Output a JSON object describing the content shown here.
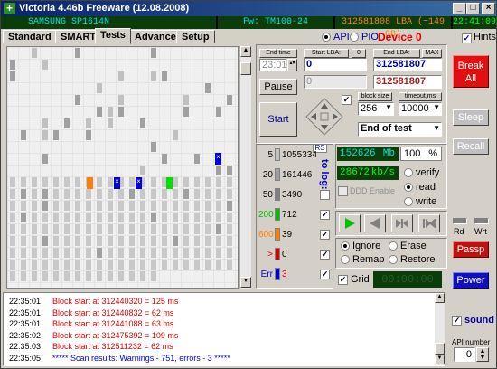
{
  "title": "Victoria 4.46b Freeware (12.08.2008)",
  "infobar": {
    "model": "SAMSUNG SP1614N",
    "fw": "Fw: TM100-24",
    "lba": "312581808 LBA (~149 GB)",
    "time": "22:41:09"
  },
  "tabs": [
    "Standard",
    "SMART",
    "Tests",
    "Advanced",
    "Setup"
  ],
  "mode": {
    "api": "API",
    "pio": "PIO",
    "device": "Device 0",
    "hints": "Hints"
  },
  "test": {
    "end_time_label": "End time",
    "end_time": "23:01",
    "start_lba_label": "Start LBA:",
    "start_lba_zero": "0",
    "start_lba": "0",
    "end_lba_label": "End LBA:",
    "end_lba_max": "MAX",
    "end_lba": "312581807",
    "end_lba2": "312581807",
    "field2": "0",
    "pause": "Pause",
    "start": "Start",
    "block_size_label": "block size",
    "block_size": "256",
    "timeout_label": "timeout,ms",
    "timeout": "10000",
    "end_of_test": "End of test"
  },
  "stats": {
    "rs": "RS",
    "to_log": "to log:",
    "rows": [
      {
        "ms": "5",
        "count": "1055334",
        "color": "#c0c0c0"
      },
      {
        "ms": "20",
        "count": "161446",
        "color": "#a0a0a0"
      },
      {
        "ms": "50",
        "count": "3490",
        "color": "#808080"
      },
      {
        "ms": "200",
        "count": "712",
        "color": "#00c000"
      },
      {
        "ms": "600",
        "count": "39",
        "color": "#ff8000"
      },
      {
        "ms": ">",
        "count": "0",
        "color": "#e00000"
      },
      {
        "ms": "Err",
        "count": "3",
        "color": "#0000e0"
      }
    ]
  },
  "progress": {
    "mb": "152626",
    "mb_unit": "Mb",
    "pct": "100",
    "pct_unit": "%",
    "speed": "28672",
    "speed_unit": "kb/s",
    "verify": "verify",
    "read": "read",
    "write": "write",
    "ddd": "DDD Enable"
  },
  "actions": {
    "ignore": "Ignore",
    "erase": "Erase",
    "remap": "Remap",
    "restore": "Restore",
    "grid": "Grid",
    "grid_time": "00:00:00"
  },
  "right": {
    "break": "Break All",
    "sleep": "Sleep",
    "recall": "Recall",
    "rd": "Rd",
    "wrt": "Wrt",
    "passp": "Passp",
    "power": "Power",
    "sound": "sound",
    "api_number_label": "API number",
    "api_number": "0"
  },
  "log": [
    {
      "time": "22:35:01",
      "text": "Block start at 312440320 = 125 ms",
      "color": "#e00000"
    },
    {
      "time": "22:35:01",
      "text": "Block start at 312440832 = 62 ms",
      "color": "#e00000"
    },
    {
      "time": "22:35:01",
      "text": "Block start at 312441088 = 63 ms",
      "color": "#e00000"
    },
    {
      "time": "22:35:02",
      "text": "Block start at 312475392 = 109 ms",
      "color": "#e00000"
    },
    {
      "time": "22:35:03",
      "text": "Block start at 312511232 = 62 ms",
      "color": "#e00000"
    },
    {
      "time": "22:35:05",
      "text": "***** Scan results: Warnings - 751, errors - 3 *****",
      "color": "#0000e0"
    }
  ]
}
